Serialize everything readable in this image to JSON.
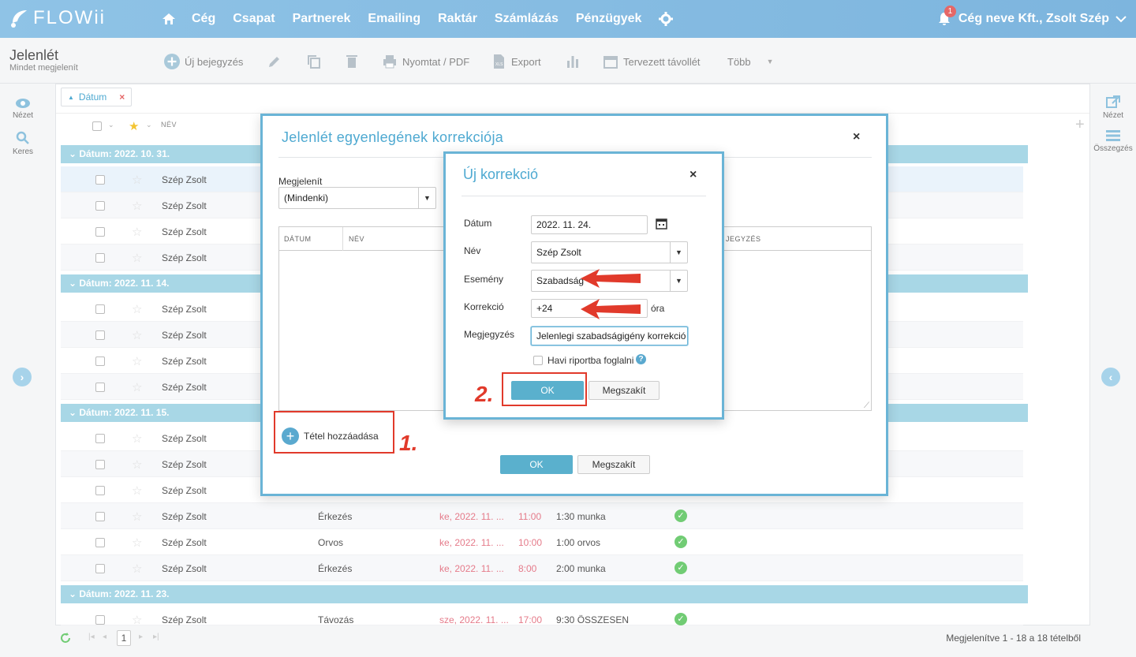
{
  "app": {
    "logo_text": "FLOWii",
    "nav": [
      "Cég",
      "Csapat",
      "Partnerek",
      "Emailing",
      "Raktár",
      "Számlázás",
      "Pénzügyek"
    ],
    "user": "Cég neve Kft., Zsolt Szép",
    "notification_count": "1"
  },
  "toolbar": {
    "title": "Jelenlét",
    "subtitle": "Mindet megjelenít",
    "new_entry": "Új bejegyzés",
    "print": "Nyomtat / PDF",
    "export": "Export",
    "planned_absence": "Tervezett távollét",
    "more": "Több"
  },
  "rails": {
    "view_left": "Nézet",
    "search": "Keres",
    "view_right": "Nézet",
    "summary": "Összegzés"
  },
  "list": {
    "filter_chip": "Dátum",
    "col_name": "NÉV",
    "groups": [
      {
        "label": "Dátum: 2022. 10. 31.",
        "rows": [
          {
            "name": "Szép Zsolt"
          },
          {
            "name": "Szép Zsolt"
          },
          {
            "name": "Szép Zsolt"
          },
          {
            "name": "Szép Zsolt"
          }
        ]
      },
      {
        "label": "Dátum: 2022. 11. 14.",
        "rows": [
          {
            "name": "Szép Zsolt"
          },
          {
            "name": "Szép Zsolt"
          },
          {
            "name": "Szép Zsolt"
          },
          {
            "name": "Szép Zsolt"
          }
        ]
      },
      {
        "label": "Dátum: 2022. 11. 15.",
        "rows": [
          {
            "name": "Szép Zsolt"
          },
          {
            "name": "Szép Zsolt"
          },
          {
            "name": "Szép Zsolt"
          },
          {
            "name": "Szép Zsolt",
            "event": "Érkezés",
            "date": "ke, 2022. 11. ...",
            "time": "11:00",
            "note": "1:30 munka"
          },
          {
            "name": "Szép Zsolt",
            "event": "Orvos",
            "date": "ke, 2022. 11. ...",
            "time": "10:00",
            "note": "1:00 orvos"
          },
          {
            "name": "Szép Zsolt",
            "event": "Érkezés",
            "date": "ke, 2022. 11. ...",
            "time": "8:00",
            "note": "2:00 munka"
          }
        ]
      },
      {
        "label": "Dátum: 2022. 11. 23.",
        "rows": [
          {
            "name": "Szép Zsolt",
            "event": "Távozás",
            "date": "sze, 2022. 11. ...",
            "time": "17:00",
            "note": "9:30 ÖSSZESEN"
          }
        ]
      }
    ],
    "footer_page": "1",
    "footer_status": "Megjelenítve 1 - 18 a 18 tételből"
  },
  "dialog1": {
    "title": "Jelenlét egyenlegének korrekciója",
    "show_label": "Megjelenít",
    "show_value": "(Mindenki)",
    "col_date": "DÁTUM",
    "col_name": "NÉV",
    "col_note": "JEGYZÉS",
    "add_item": "Tétel hozzáadása",
    "ok": "OK",
    "cancel": "Megszakít"
  },
  "dialog2": {
    "title": "Új korrekció",
    "date_label": "Dátum",
    "date_value": "2022. 11. 24.",
    "name_label": "Név",
    "name_value": "Szép Zsolt",
    "event_label": "Esemény",
    "event_value": "Szabadság",
    "correction_label": "Korrekció",
    "correction_value": "+24",
    "correction_unit": "óra",
    "note_label": "Megjegyzés",
    "note_value": "Jelenlegi szabadságigény korrekció",
    "monthly_report": "Havi riportba foglalni",
    "ok": "OK",
    "cancel": "Megszakít"
  },
  "annotations": {
    "step1": "1.",
    "step2": "2."
  },
  "colors": {
    "nav_bg": "#8fc3e6",
    "accent": "#4ea9d1",
    "group_row": "#a8d7e6",
    "annotation_red": "#e13a2b",
    "ok_green": "#71cc74"
  }
}
